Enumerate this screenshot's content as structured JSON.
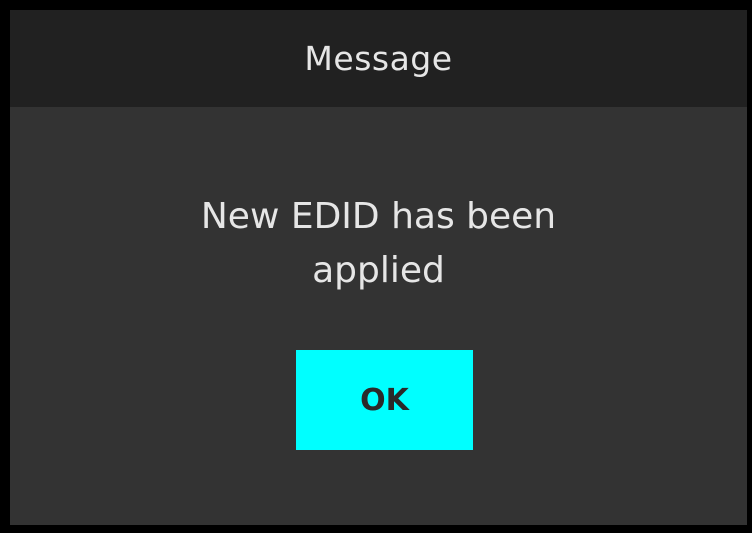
{
  "dialog": {
    "title": "Message",
    "message": "New EDID has been\napplied",
    "ok_label": "OK"
  },
  "colors": {
    "frame": "#000000",
    "background": "#333333",
    "titlebar": "#212121",
    "text": "#e6e6e6",
    "button": "#00ffff",
    "button_text": "#2a2a2a"
  }
}
